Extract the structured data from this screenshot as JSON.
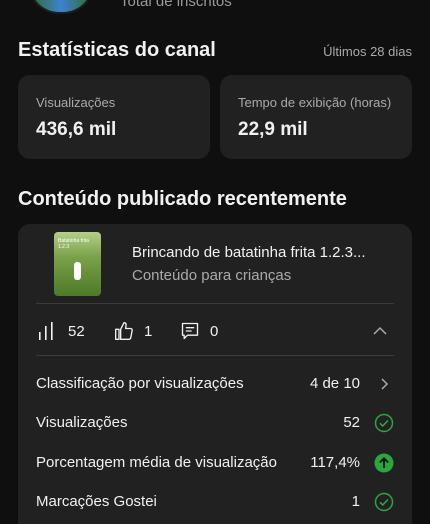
{
  "header": {
    "subscribers_label": "Total de inscritos"
  },
  "stats": {
    "title": "Estatísticas do canal",
    "period": "Últimos 28 dias",
    "cards": [
      {
        "label": "Visualizações",
        "value": "436,6 mil"
      },
      {
        "label": "Tempo de exibição (horas)",
        "value": "22,9 mil"
      }
    ]
  },
  "recent": {
    "title": "Conteúdo publicado recentemente",
    "video": {
      "thumbnail_text": "Batatinha frita 1.2.3",
      "title": "Brincando de batatinha frita 1.2.3...",
      "subtitle": "Conteúdo para crianças"
    },
    "metrics": {
      "views": "52",
      "likes": "1",
      "comments": "0"
    },
    "rows": [
      {
        "label": "Classificação por visualizações",
        "value": "4 de 10",
        "icon": "chevron-right-icon"
      },
      {
        "label": "Visualizações",
        "value": "52",
        "icon": "check-circle-icon"
      },
      {
        "label": "Porcentagem média de visualização",
        "value": "117,4%",
        "icon": "arrow-up-circle-icon"
      },
      {
        "label": "Marcações Gostei",
        "value": "1",
        "icon": "check-circle-icon"
      }
    ]
  },
  "colors": {
    "background": "#0f0f0f",
    "card": "#212121",
    "positive": "#2ba640",
    "secondary_text": "#aaaaaa"
  }
}
